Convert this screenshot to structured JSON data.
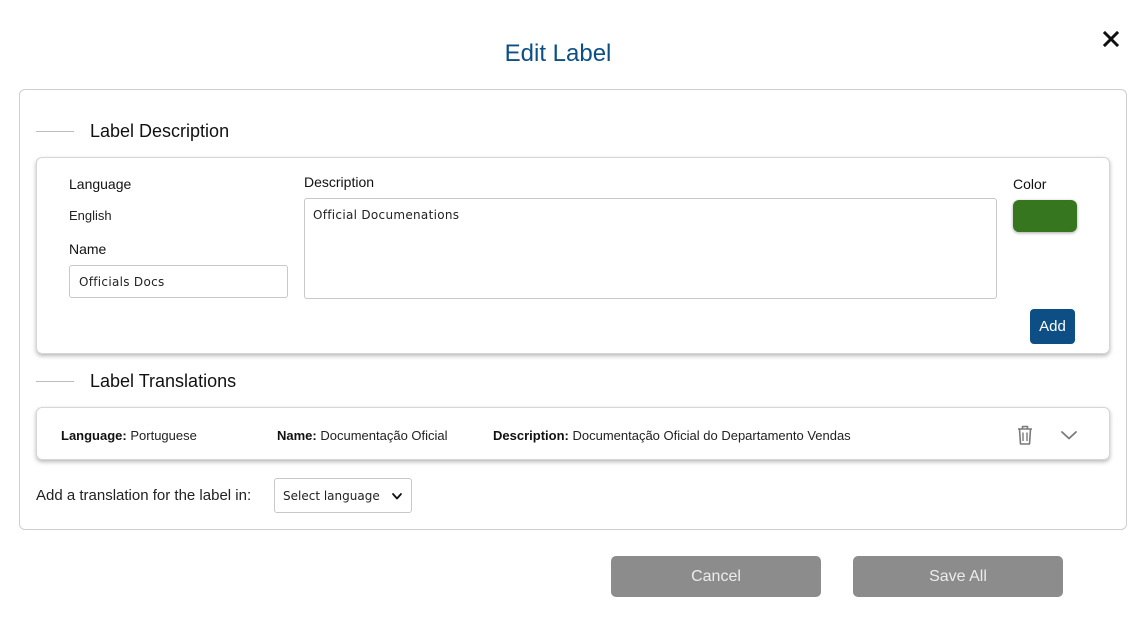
{
  "dialog": {
    "title": "Edit Label",
    "close_icon": "close-icon"
  },
  "label_description": {
    "heading": "Label Description",
    "language_label": "Language",
    "language_value": "English",
    "name_label": "Name",
    "name_value": "Officials Docs",
    "description_label": "Description",
    "description_value": "Official Documenations",
    "color_label": "Color",
    "color_value": "#35761f",
    "add_label": "Add"
  },
  "label_translations": {
    "heading": "Label Translations",
    "items": [
      {
        "language_key": "Language:",
        "language_value": "Portuguese",
        "name_key": "Name:",
        "name_value": "Documentação Oficial",
        "description_key": "Description:",
        "description_value": "Documentação Oficial do Departamento Vendas",
        "delete_icon": "trash-icon",
        "expand_icon": "chevron-down-icon"
      }
    ],
    "add_prompt": "Add a translation for the label in:",
    "select_language": "Select language"
  },
  "footer": {
    "cancel_label": "Cancel",
    "save_all_label": "Save All"
  },
  "colors": {
    "accent": "#0d4f85",
    "disabled_button": "#8c8c8c"
  }
}
